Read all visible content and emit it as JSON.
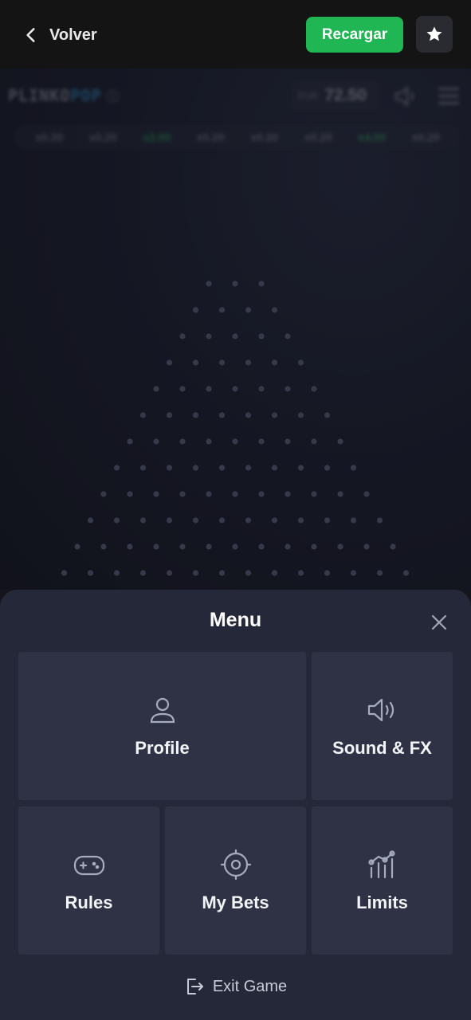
{
  "topbar": {
    "back_label": "Volver",
    "reload_label": "Recargar",
    "favorite_icon": "star-icon",
    "accent_color": "#1fb653"
  },
  "game": {
    "logo_part1": "PLINKO",
    "logo_part2": "POP",
    "currency": "EUR",
    "balance": "72.50",
    "history": [
      "x0.20",
      "x0.20",
      "x2.00",
      "x0.20",
      "x0.20",
      "x0.20",
      "x4.00",
      "x0.20"
    ]
  },
  "menu": {
    "title": "Menu",
    "items": [
      {
        "label": "Profile",
        "icon": "user-icon"
      },
      {
        "label": "Sound & FX",
        "icon": "speaker-icon"
      },
      {
        "label": "Rules",
        "icon": "gamepad-icon"
      },
      {
        "label": "My Bets",
        "icon": "target-icon"
      },
      {
        "label": "Limits",
        "icon": "limits-icon"
      }
    ],
    "exit_label": "Exit Game"
  }
}
